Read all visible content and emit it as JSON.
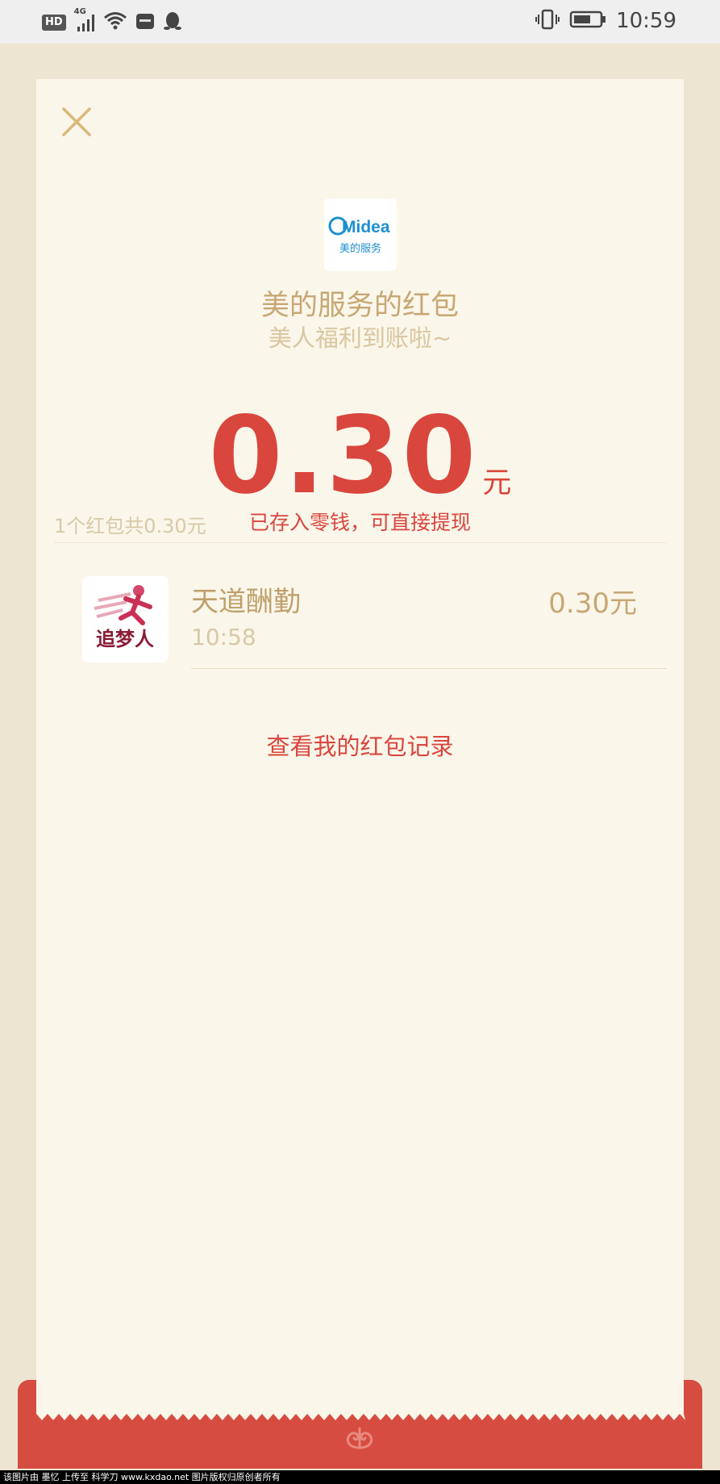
{
  "status_bar": {
    "hd_label": "HD",
    "network_label": "4G",
    "time": "10:59"
  },
  "logo": {
    "brand_text": "Midea",
    "caption": "美的服务"
  },
  "envelope": {
    "title": "美的服务的红包",
    "subtitle": "美人福利到账啦~",
    "amount": "0.30",
    "unit": "元",
    "stored_note": "已存入零钱，可直接提现"
  },
  "summary": "1个红包共0.30元",
  "records": [
    {
      "name": "天道酬勤",
      "time": "10:58",
      "amount": "0.30元",
      "avatar_text": "追梦人"
    }
  ],
  "history_link": "查看我的红包记录",
  "footer_watermark": "该图片由 墨忆 上传至 科学刀 www.kxdao.net 图片版权归原创者所有",
  "colors": {
    "accent_red": "#d9463e",
    "gold_text": "#c7a774",
    "card_bg": "#faf6ea",
    "page_bg": "#ede5d2"
  }
}
